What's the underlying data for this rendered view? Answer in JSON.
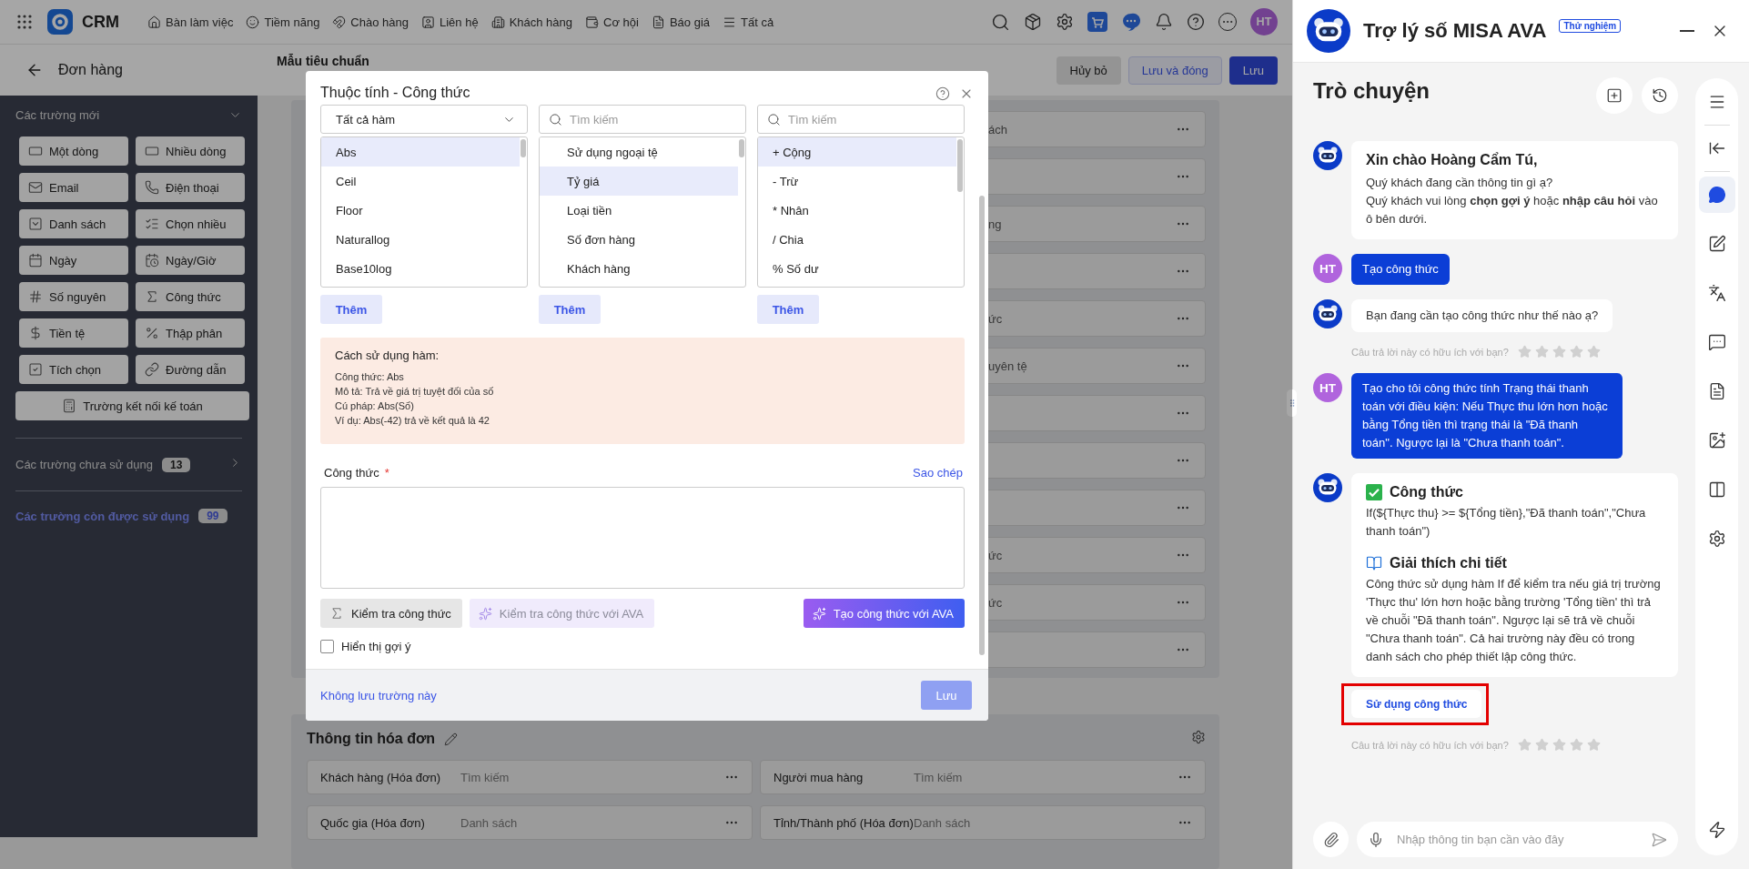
{
  "app": {
    "brand": "CRM",
    "nav": [
      {
        "label": "Bàn làm việc"
      },
      {
        "label": "Tiềm năng"
      },
      {
        "label": "Chào hàng"
      },
      {
        "label": "Liên hệ"
      },
      {
        "label": "Khách hàng"
      },
      {
        "label": "Cơ hội"
      },
      {
        "label": "Báo giá"
      },
      {
        "label": "Tất cả"
      }
    ],
    "user_initials": "HT"
  },
  "page_header": {
    "title": "Đơn hàng",
    "layout_name": "Mẫu tiêu chuẩn",
    "buttons": [
      {
        "label": "Hủy bỏ",
        "kind": "secondary"
      },
      {
        "label": "Lưu và đóng",
        "kind": "outline"
      },
      {
        "label": "Lưu",
        "kind": "primary"
      }
    ]
  },
  "field_panel": {
    "title": "Các trường mới",
    "expanded": true,
    "field_types": [
      "Một dòng",
      "Nhiều dòng",
      "Email",
      "Điện thoại",
      "Danh sách",
      "Chọn nhiều",
      "Ngày",
      "Ngày/Giờ",
      "Số nguyên",
      "Công thức",
      "Tiền tệ",
      "Thập phân",
      "Tích chọn",
      "Đường dẫn"
    ],
    "wide_type": "Trường kết nối kế toán",
    "unused": {
      "label": "Các trường chưa sử dụng",
      "count": "13"
    },
    "available": {
      "label": "Các trường còn được sử dụng",
      "count": "99"
    }
  },
  "form_rows": [
    {
      "kind": "text",
      "text": "ách"
    },
    {
      "kind": "empty"
    },
    {
      "kind": "text",
      "text": "ng"
    },
    {
      "kind": "empty"
    },
    {
      "kind": "text",
      "text": "ức"
    },
    {
      "kind": "text",
      "text": "uyên tệ"
    },
    {
      "kind": "empty"
    },
    {
      "kind": "empty"
    },
    {
      "kind": "empty"
    },
    {
      "kind": "text",
      "text": "ức"
    },
    {
      "kind": "text",
      "text": "ức"
    },
    {
      "kind": "empty"
    }
  ],
  "invoice_section": {
    "title": "Thông tin hóa đơn",
    "fields": [
      {
        "label": "Khách hàng (Hóa đơn)",
        "placeholder": "Tìm kiếm"
      },
      {
        "label": "Người mua hàng",
        "placeholder": "Tìm kiếm"
      },
      {
        "label": "Quốc gia (Hóa đơn)",
        "placeholder": "Danh sách"
      },
      {
        "label": "Tỉnh/Thành phố (Hóa đơn)",
        "placeholder": "Danh sách"
      }
    ]
  },
  "dialog": {
    "title": "Thuộc tính - Công thức",
    "columns": [
      {
        "kind": "select",
        "value": "Tất cả hàm",
        "add": "Thêm",
        "items": [
          {
            "label": "Abs",
            "selected": true
          },
          {
            "label": "Ceil",
            "selected": false
          },
          {
            "label": "Floor",
            "selected": false
          },
          {
            "label": "Naturallog",
            "selected": false
          },
          {
            "label": "Base10log",
            "selected": false
          }
        ]
      },
      {
        "kind": "search",
        "placeholder": "Tìm kiếm",
        "add": "Thêm",
        "items": [
          {
            "label": "Sử dụng ngoại tệ",
            "selected": false
          },
          {
            "label": "Tỷ giá",
            "selected": true
          },
          {
            "label": "Loại tiền",
            "selected": false
          },
          {
            "label": "Số đơn hàng",
            "selected": false
          },
          {
            "label": "Khách hàng",
            "selected": false
          }
        ]
      },
      {
        "kind": "search",
        "placeholder": "Tìm kiếm",
        "add": "Thêm",
        "items": [
          {
            "label": "+ Cộng",
            "selected": true
          },
          {
            "label": "- Trừ",
            "selected": false
          },
          {
            "label": "* Nhân",
            "selected": false
          },
          {
            "label": "/ Chia",
            "selected": false
          },
          {
            "label": "% Số dư",
            "selected": false
          }
        ]
      }
    ],
    "usage": {
      "title": "Cách sử dụng hàm:",
      "lines": [
        "Công thức: Abs",
        "Mô tả: Trả về giá trị tuyệt đối của số",
        "Cú pháp: Abs(Số)",
        "Ví dụ: Abs(-42) trả về kết quả là 42"
      ]
    },
    "formula": {
      "label": "Công thức",
      "required_mark": "*",
      "copy": "Sao chép"
    },
    "actions": [
      {
        "kind": "check",
        "label": "Kiểm tra công thức",
        "disabled": false
      },
      {
        "kind": "ava-check",
        "label": "Kiểm tra công thức với AVA",
        "disabled": true
      },
      {
        "kind": "ava-create",
        "label": "Tạo công thức với AVA",
        "disabled": false
      }
    ],
    "show_hints": {
      "label": "Hiển thị gợi ý",
      "checked": false
    },
    "discard": "Không lưu trường này",
    "save": {
      "label": "Lưu",
      "disabled": true
    }
  },
  "assistant": {
    "title": "Trợ lý số MISA AVA",
    "badge": "Thử nghiệm",
    "section": "Trò chuyện",
    "messages": [
      {
        "kind": "bot-greeting",
        "heading": "Xin chào Hoàng Cẩm Tú,",
        "lines": [
          "Quý khách đang cần thông tin gì ạ?",
          "Quý khách vui lòng **chọn gợi ý** hoặc **nhập câu hỏi** vào ô bên dưới."
        ]
      },
      {
        "kind": "user",
        "initials": "HT",
        "text": "Tạo công thức"
      },
      {
        "kind": "bot",
        "text": "Bạn đang cần tạo công thức như thế nào ạ?"
      },
      {
        "kind": "rating",
        "text": "Câu trả lời này có hữu ích với bạn?",
        "stars": 0
      },
      {
        "kind": "user",
        "initials": "HT",
        "text": "Tạo cho tôi công thức tính Trạng thái thanh toán với điều kiện: Nếu Thực thu lớn hơn hoặc bằng Tổng tiền thì trạng thái là \"Đã thanh toán\". Ngược lại là \"Chưa thanh toán\"."
      },
      {
        "kind": "bot-formula",
        "sections": [
          {
            "kind": "check",
            "heading": "Công thức",
            "text": "If(${Thực thu} >= ${Tổng tiền},\"Đã thanh toán\",\"Chưa thanh toán\")"
          },
          {
            "kind": "book",
            "heading": "Giải thích chi tiết",
            "text": "Công thức sử dụng hàm If để kiểm tra nếu giá trị trường 'Thực thu' lớn hơn hoặc bằng trường 'Tổng tiền' thì trả về chuỗi \"Đã thanh toán\". Ngược lại sẽ trả về chuỗi \"Chưa thanh toán\". Cả hai trường này đều có trong danh sách cho phép thiết lập công thức."
          }
        ],
        "action": {
          "label": "Sử dụng công thức",
          "highlighted": true
        }
      },
      {
        "kind": "rating",
        "text": "Câu trả lời này có hữu ích với bạn?",
        "stars": 0
      }
    ],
    "input_placeholder": "Nhập thông tin bạn cần vào đây",
    "rail": [
      {
        "selected": false
      },
      {
        "selected": false
      },
      {
        "selected": true
      },
      {
        "selected": false
      },
      {
        "selected": false
      },
      {
        "selected": false
      },
      {
        "selected": false
      },
      {
        "selected": false
      },
      {
        "selected": false
      },
      {
        "selected": false
      }
    ]
  }
}
